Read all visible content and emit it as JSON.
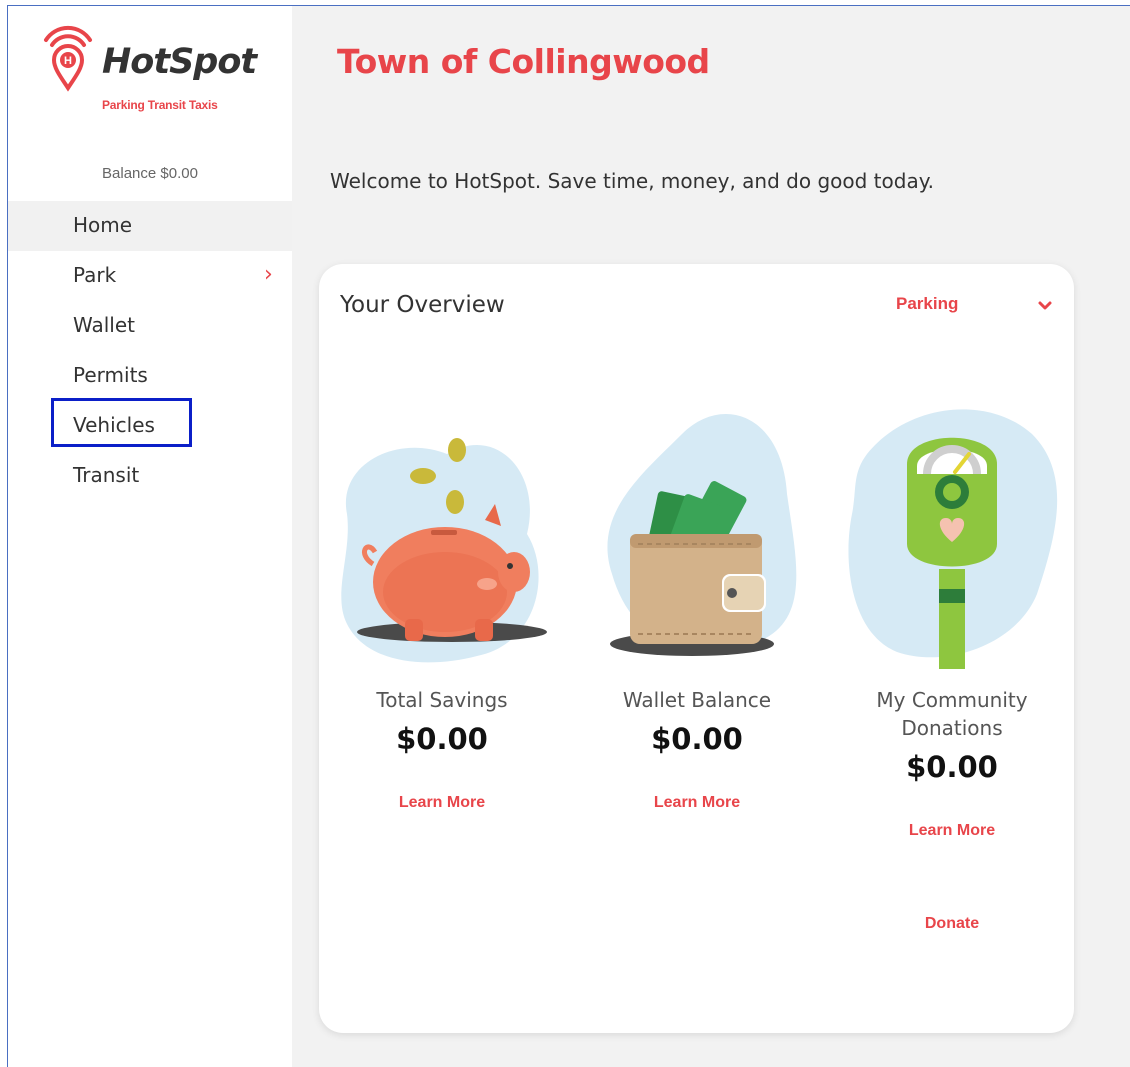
{
  "brand": {
    "name": "HotSpot",
    "tagline": "Parking Transit Taxis",
    "logo_icon": "location-pin-wifi-icon"
  },
  "sidebar": {
    "balance": "Balance $0.00",
    "items": [
      {
        "label": "Home",
        "active": true
      },
      {
        "label": "Park",
        "has_submenu": true
      },
      {
        "label": "Wallet"
      },
      {
        "label": "Permits"
      },
      {
        "label": "Vehicles",
        "highlighted": true
      },
      {
        "label": "Transit"
      }
    ]
  },
  "main": {
    "title": "Town of Collingwood",
    "welcome": "Welcome to HotSpot. Save time, money, and do good today."
  },
  "overview": {
    "title": "Your Overview",
    "filter": "Parking",
    "tiles": [
      {
        "label": "Total Savings",
        "value": "$0.00",
        "link": "Learn More",
        "icon": "piggy-bank-icon"
      },
      {
        "label": "Wallet Balance",
        "value": "$0.00",
        "link": "Learn More",
        "icon": "wallet-icon"
      },
      {
        "label": "My Community Donations",
        "value": "$0.00",
        "link": "Learn More",
        "secondary_link": "Donate",
        "icon": "parking-meter-icon"
      }
    ]
  },
  "colors": {
    "accent": "#e8454a",
    "highlight_box": "#0b1fc8",
    "main_bg": "#f2f2f2"
  }
}
